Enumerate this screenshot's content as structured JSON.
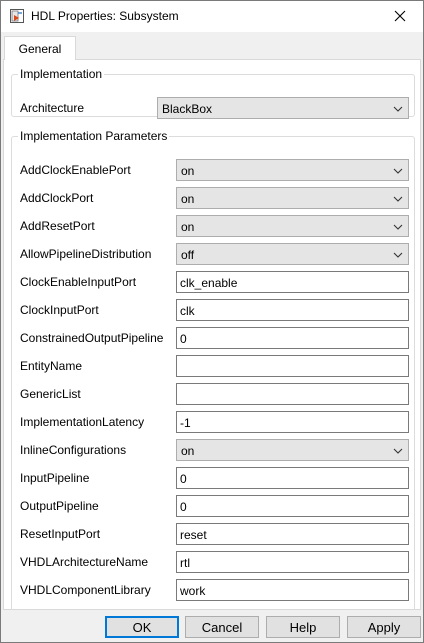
{
  "window": {
    "title": "HDL Properties: Subsystem"
  },
  "tabs": [
    {
      "label": "General"
    }
  ],
  "implementation": {
    "legend": "Implementation",
    "architecture_label": "Architecture",
    "architecture_value": "BlackBox"
  },
  "parameters": {
    "legend": "Implementation Parameters",
    "rows": [
      {
        "label": "AddClockEnablePort",
        "value": "on",
        "kind": "combo"
      },
      {
        "label": "AddClockPort",
        "value": "on",
        "kind": "combo"
      },
      {
        "label": "AddResetPort",
        "value": "on",
        "kind": "combo"
      },
      {
        "label": "AllowPipelineDistribution",
        "value": "off",
        "kind": "combo"
      },
      {
        "label": "ClockEnableInputPort",
        "value": "clk_enable",
        "kind": "text"
      },
      {
        "label": "ClockInputPort",
        "value": "clk",
        "kind": "text"
      },
      {
        "label": "ConstrainedOutputPipeline",
        "value": "0",
        "kind": "text"
      },
      {
        "label": "EntityName",
        "value": "",
        "kind": "text"
      },
      {
        "label": "GenericList",
        "value": "",
        "kind": "text"
      },
      {
        "label": "ImplementationLatency",
        "value": "-1",
        "kind": "text"
      },
      {
        "label": "InlineConfigurations",
        "value": "on",
        "kind": "combo"
      },
      {
        "label": "InputPipeline",
        "value": "0",
        "kind": "text"
      },
      {
        "label": "OutputPipeline",
        "value": "0",
        "kind": "text"
      },
      {
        "label": "ResetInputPort",
        "value": "reset",
        "kind": "text"
      },
      {
        "label": "VHDLArchitectureName",
        "value": "rtl",
        "kind": "text"
      },
      {
        "label": "VHDLComponentLibrary",
        "value": "work",
        "kind": "text"
      }
    ]
  },
  "buttons": {
    "ok": "OK",
    "cancel": "Cancel",
    "help": "Help",
    "apply": "Apply"
  },
  "colors": {
    "default_button_border": "#0078d7",
    "dialog_background": "#f0f0f0"
  },
  "icons": {
    "app": "simulink-block-icon",
    "close": "close-icon",
    "dropdown": "chevron-down-icon"
  }
}
